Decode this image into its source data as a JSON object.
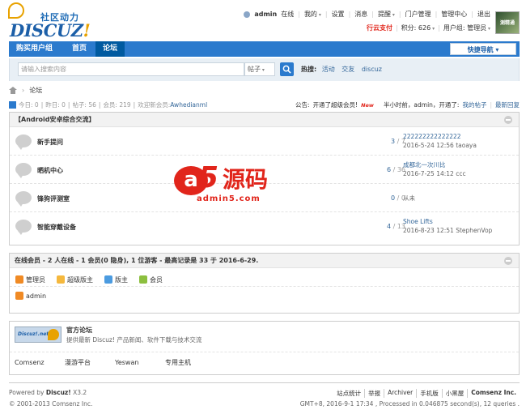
{
  "header": {
    "logo_sub": "社区动力",
    "logo_main_a": "DISCUZ",
    "logo_main_b": "!",
    "user": {
      "name": "admin",
      "status": "在线",
      "menu": [
        "我的",
        "设置",
        "消息",
        "提醒",
        "门户管理",
        "管理中心",
        "退出"
      ]
    },
    "row2": {
      "pay": "行云支付",
      "credits": "积分: 626",
      "group": "用户组: 管理员"
    },
    "avatar_label": "测精通"
  },
  "nav": {
    "items": [
      "购买用户组",
      "首页",
      "论坛"
    ],
    "active_index": 2,
    "quick": "快捷导航"
  },
  "search": {
    "placeholder": "请输入搜索内容",
    "type": "帖子",
    "hot_label": "热搜:",
    "hot": [
      "活动",
      "交友",
      "discuz"
    ]
  },
  "breadcrumb": {
    "current": "论坛"
  },
  "stats": {
    "today": "今日: 0",
    "yesterday": "昨日: 0",
    "posts": "帖子: 56",
    "members": "会员: 219",
    "welcome": "欢迎新会员: ",
    "new_member": "Awhedianml"
  },
  "announce": {
    "label": "公告:",
    "text": "开通了超级会员!",
    "badge": "New",
    "meta": "半小时前，admin，开通了:",
    "my_posts": "我的帖子",
    "latest": "最新回复"
  },
  "category": {
    "title": "【Android安卓综合交流】",
    "forums": [
      {
        "name": "新手提问",
        "threads": "3",
        "posts": "7",
        "last_title": "222222222222222",
        "last_meta": "2016-5-24 12:56 taoaya"
      },
      {
        "name": "晒机中心",
        "threads": "6",
        "posts": "36",
        "last_title": "成都北一次川比",
        "last_meta": "2016-7-25 14:12 ccc"
      },
      {
        "name": "锋狗评测室",
        "threads": "0",
        "posts": "0",
        "last_title": "从未",
        "last_meta": ""
      },
      {
        "name": "智能穿戴设备",
        "threads": "4",
        "posts": "13",
        "last_title": "Shoe Lifts",
        "last_meta": "2016-8-23 12:51 StephenVop"
      }
    ]
  },
  "online": {
    "title": "在线会员 - 2 人在线 - 1 会员(0 隐身), 1 位游客 - 最高记录是 33 于 2016-6-29.",
    "legend": [
      {
        "label": "管理员",
        "color": "#f08a24"
      },
      {
        "label": "超级版主",
        "color": "#f5b83d"
      },
      {
        "label": "版主",
        "color": "#4b9be0"
      },
      {
        "label": "会员",
        "color": "#8cbf3f"
      }
    ],
    "users": [
      {
        "name": "admin",
        "color": "#f08a24"
      }
    ]
  },
  "links": {
    "logo_text": "Discuz!.net",
    "official_name": "官方论坛",
    "official_desc": "提供最新 Discuz! 产品新闻、软件下载与技术交流",
    "items": [
      "Comsenz",
      "漫游平台",
      "Yeswan",
      "专用主机"
    ]
  },
  "footer": {
    "powered_by": "Powered by",
    "product": "Discuz!",
    "version": "X3.2",
    "copyright": "© 2001-2013 Comsenz Inc.",
    "links": [
      "站点统计",
      "举报",
      "Archiver",
      "手机版",
      "小黑屋",
      "Comsenz Inc."
    ],
    "time": "GMT+8, 2016-9-1 17:34 , Processed in 0.046875 second(s), 12 queries ."
  },
  "watermark": {
    "brand_a": "a",
    "brand_5": "5",
    "brand_cn": "源码",
    "url": "admin5.com"
  },
  "colors": {
    "nav": "#2b7acd",
    "nav_active": "#005aa0",
    "link": "#336699",
    "accent_red": "#e1251b"
  }
}
